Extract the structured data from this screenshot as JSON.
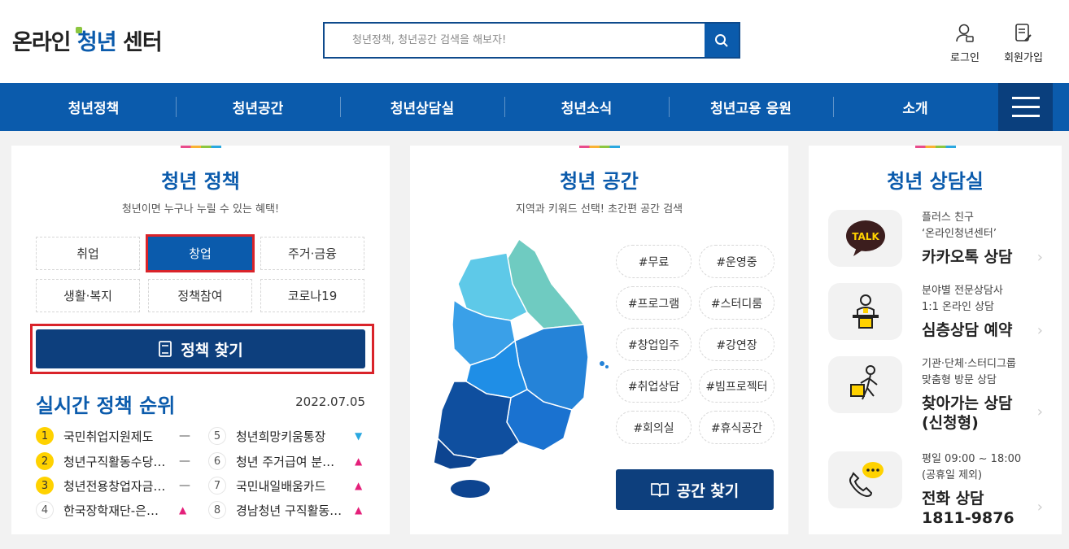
{
  "header": {
    "logo_pre": "온라인 ",
    "logo_main": "청년",
    "logo_post": " 센터",
    "search_placeholder": "청년정책, 청년공간 검색을 해보자!",
    "login": "로그인",
    "signup": "회원가입"
  },
  "nav": [
    "청년정책",
    "청년공간",
    "청년상담실",
    "청년소식",
    "청년고용 응원",
    "소개"
  ],
  "policy": {
    "title": "청년 정책",
    "subtitle": "청년이면 누구나 누릴 수 있는 혜택!",
    "tags": [
      "취업",
      "창업",
      "주거·금융",
      "생활·복지",
      "정책참여",
      "코로나19"
    ],
    "active_tag": "창업",
    "find_button": "정책 찾기",
    "rank_title": "실시간 정책 순위",
    "rank_date": "2022.07.05",
    "ranks": [
      {
        "num": "1",
        "text": "국민취업지원제도",
        "trend": "same"
      },
      {
        "num": "2",
        "text": "청년구직활동수당…",
        "trend": "same"
      },
      {
        "num": "3",
        "text": "청년전용창업자금…",
        "trend": "same"
      },
      {
        "num": "4",
        "text": "한국장학재단-은…",
        "trend": "up"
      },
      {
        "num": "5",
        "text": "청년희망키움통장",
        "trend": "down"
      },
      {
        "num": "6",
        "text": "청년 주거급여 분…",
        "trend": "up"
      },
      {
        "num": "7",
        "text": "국민내일배움카드",
        "trend": "up"
      },
      {
        "num": "8",
        "text": "경남청년 구직활동…",
        "trend": "up"
      }
    ]
  },
  "space": {
    "title": "청년 공간",
    "subtitle": "지역과 키워드 선택! 초간편 공간 검색",
    "hashtags": [
      "#무료",
      "#운영중",
      "#프로그램",
      "#스터디룸",
      "#창업입주",
      "#강연장",
      "#취업상담",
      "#빔프로젝터",
      "#회의실",
      "#휴식공간"
    ],
    "find_button": "공간 찾기"
  },
  "counsel": {
    "title": "청년 상담실",
    "items": [
      {
        "icon": "kakao-talk-icon",
        "line1": "플러스 친구",
        "line2": "‘온라인청년센터’",
        "big": "카카오톡 상담",
        "big2": ""
      },
      {
        "icon": "counselor-icon",
        "line1": "분야별 전문상담사",
        "line2": "1:1 온라인 상담",
        "big": "심층상담 예약",
        "big2": ""
      },
      {
        "icon": "visit-icon",
        "line1": "기관·단체·스터디그룹",
        "line2": "맞춤형 방문 상담",
        "big": "찾아가는 상담",
        "big2": "(신청형)"
      },
      {
        "icon": "phone-icon",
        "line1": "평일 09:00 ~ 18:00",
        "line2": "(공휴일 제외)",
        "big": "전화 상담",
        "big2": "1811-9876"
      }
    ]
  }
}
